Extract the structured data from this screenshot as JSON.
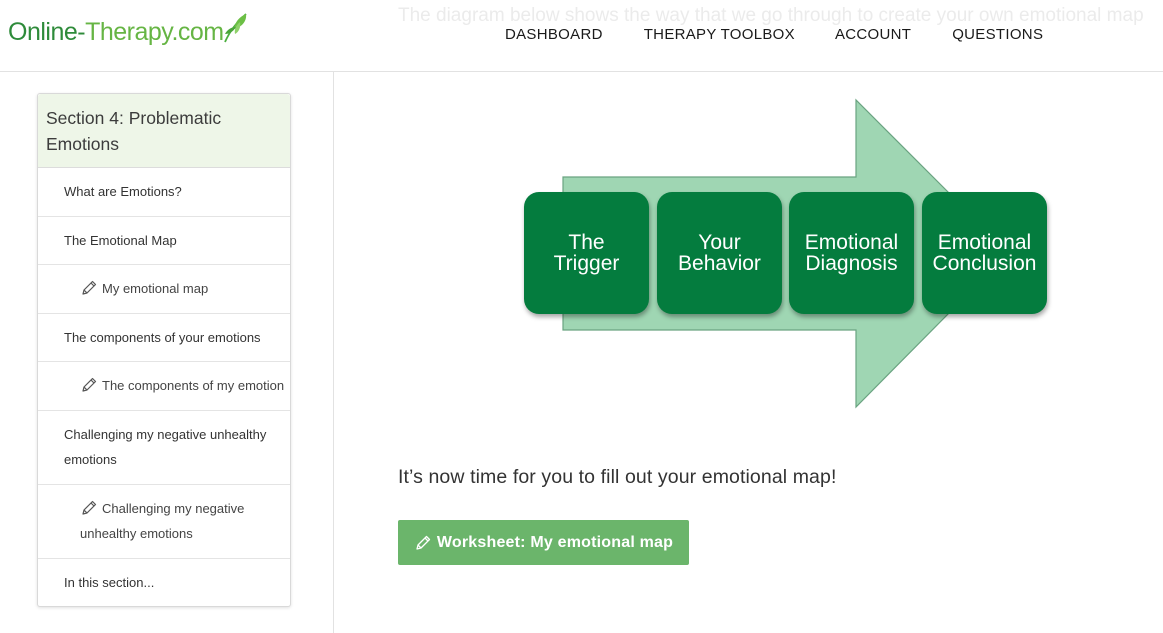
{
  "header": {
    "logo": {
      "part1": "Online-",
      "part2": "Therapy.com"
    },
    "faded_text": "The diagram below shows the way that we go through to create your own emotional map"
  },
  "nav": {
    "items": [
      {
        "label": "DASHBOARD"
      },
      {
        "label": "THERAPY TOOLBOX"
      },
      {
        "label": "ACCOUNT"
      },
      {
        "label": "QUESTIONS"
      }
    ]
  },
  "sidebar": {
    "title": "Section 4: Problematic Emotions",
    "items": [
      {
        "label": "What are Emotions?",
        "type": "section"
      },
      {
        "label": "The Emotional Map",
        "type": "section"
      },
      {
        "label": "My emotional map",
        "type": "worksheet",
        "icon": "pencil-icon"
      },
      {
        "label": "The components of your emotions",
        "type": "section"
      },
      {
        "label": "The components of my emotion",
        "type": "worksheet",
        "icon": "pencil-icon"
      },
      {
        "label": "Challenging my negative unhealthy emotions",
        "type": "section"
      },
      {
        "label": "Challenging my negative unhealthy emotions",
        "type": "worksheet",
        "icon": "pencil-icon"
      },
      {
        "label": "In this section...",
        "type": "section"
      }
    ]
  },
  "diagram": {
    "boxes": [
      {
        "line1": "The",
        "line2": "Trigger"
      },
      {
        "line1": "Your",
        "line2": "Behavior"
      },
      {
        "line1": "Emotional",
        "line2": "Diagnosis"
      },
      {
        "line1": "Emotional",
        "line2": "Conclusion"
      }
    ],
    "box_color": "#047c3e",
    "arrow_color": "#9fd6b3"
  },
  "main": {
    "prompt": "It’s now time for you to fill out your emotional map!",
    "worksheet_button": "Worksheet: My emotional map"
  },
  "colors": {
    "accent": "#6bb56b",
    "sidebar_header_bg": "#eef6e8",
    "logo_green": "#2e8b3a"
  }
}
